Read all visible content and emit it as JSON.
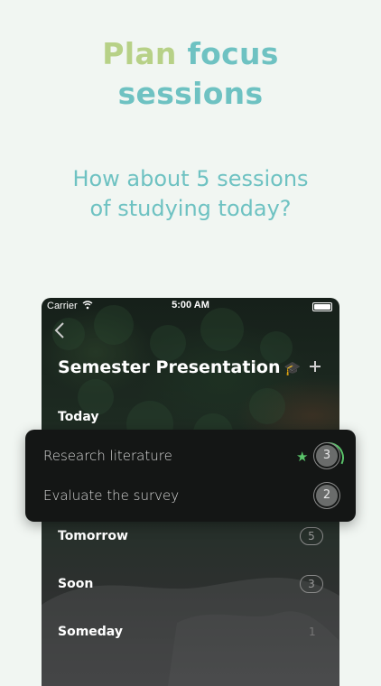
{
  "headline": {
    "word1": "Plan",
    "word2": "focus",
    "word3": "sessions"
  },
  "subtitle": {
    "line1": "How about 5 sessions",
    "line2": "of studying today?"
  },
  "colors": {
    "green": "#b7d187",
    "teal": "#6ec2c2",
    "star": "#5ac46a"
  },
  "status_bar": {
    "carrier": "Carrier",
    "time": "5:00 AM",
    "wifi_icon": "wifi-icon",
    "battery_icon": "battery-icon"
  },
  "nav": {
    "back_icon": "chevron-left-icon",
    "title": "Semester Presentation",
    "title_icon": "graduation-cap-icon",
    "add_icon": "plus-icon"
  },
  "sections": {
    "today": "Today",
    "tomorrow": {
      "label": "Tomorrow",
      "count": "5"
    },
    "soon": {
      "label": "Soon",
      "count": "3"
    },
    "someday": {
      "label": "Someday",
      "count": "1"
    }
  },
  "tasks": [
    {
      "name": "Research literature",
      "sessions": "3",
      "starred": true
    },
    {
      "name": "Evaluate the survey",
      "sessions": "2",
      "starred": false
    }
  ]
}
